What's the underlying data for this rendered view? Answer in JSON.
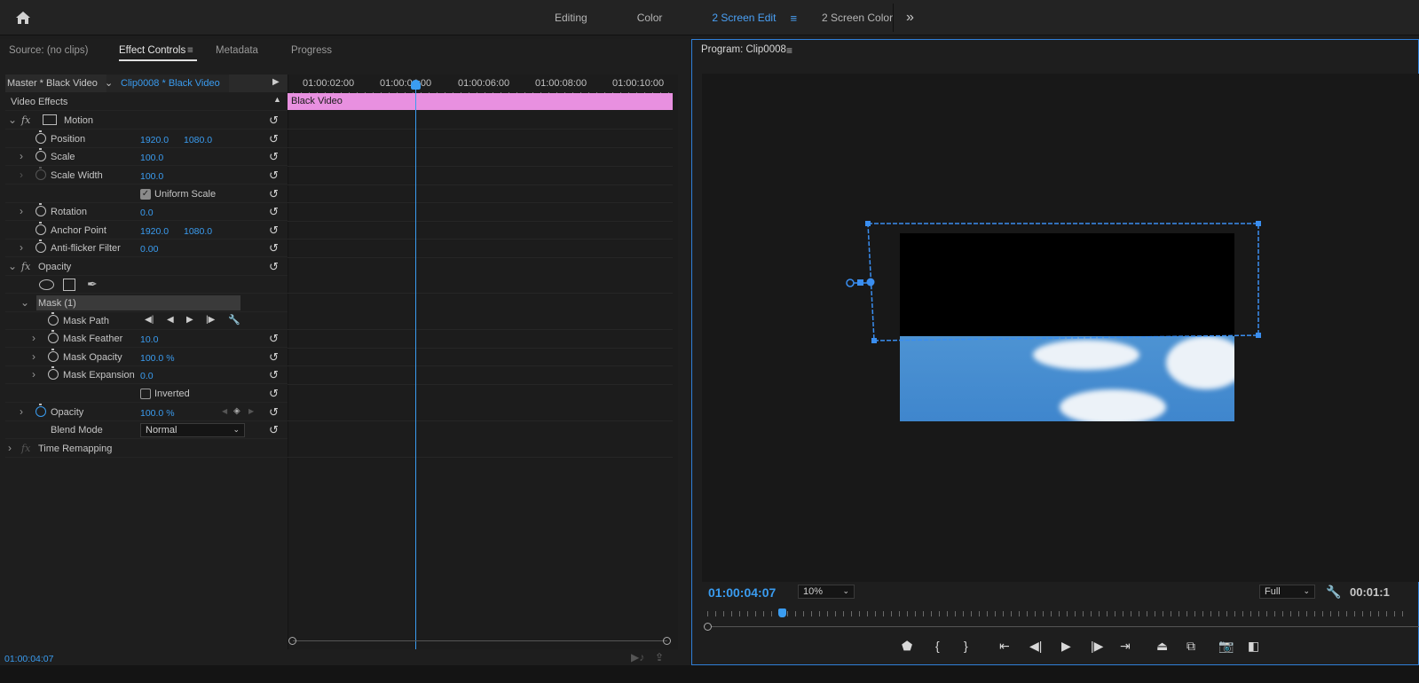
{
  "workspace": {
    "tabs": [
      {
        "label": "Editing"
      },
      {
        "label": "Color"
      },
      {
        "label": "2 Screen Edit",
        "active": true
      },
      {
        "label": "2 Screen Color"
      }
    ],
    "menu_glyph": "≡",
    "more_glyph": "»"
  },
  "left_panel": {
    "tabs": [
      "Source: (no clips)",
      "Effect Controls",
      "Metadata",
      "Progress"
    ],
    "active_tab": "Effect Controls",
    "menu_glyph": "≡",
    "master_label": "Master * Black Video",
    "clip_label": "Clip0008 * Black Video",
    "section_video_effects": "Video Effects",
    "motion": {
      "label": "Motion",
      "position": {
        "label": "Position",
        "x": "1920.0",
        "y": "1080.0"
      },
      "scale": {
        "label": "Scale",
        "value": "100.0"
      },
      "scale_width": {
        "label": "Scale Width",
        "value": "100.0"
      },
      "uniform_scale": {
        "label": "Uniform Scale",
        "checked": true
      },
      "rotation": {
        "label": "Rotation",
        "value": "0.0"
      },
      "anchor_point": {
        "label": "Anchor Point",
        "x": "1920.0",
        "y": "1080.0"
      },
      "anti_flicker": {
        "label": "Anti-flicker Filter",
        "value": "0.00"
      }
    },
    "opacity_section": {
      "label": "Opacity",
      "mask": {
        "label": "Mask (1)",
        "path_label": "Mask Path",
        "feather": {
          "label": "Mask Feather",
          "value": "10.0"
        },
        "opacity": {
          "label": "Mask Opacity",
          "value": "100.0 %"
        },
        "expansion": {
          "label": "Mask Expansion",
          "value": "0.0"
        },
        "inverted": {
          "label": "Inverted",
          "checked": false
        }
      },
      "opacity": {
        "label": "Opacity",
        "value": "100.0 %"
      },
      "blend_mode": {
        "label": "Blend Mode",
        "value": "Normal"
      }
    },
    "time_remapping": "Time Remapping",
    "timeline": {
      "timecodes": [
        "01:00:02:00",
        "01:00:04:00",
        "01:00:06:00",
        "01:00:08:00",
        "01:00:10:00"
      ],
      "clip_name": "Black Video"
    },
    "footer_timecode": "01:00:04:07"
  },
  "program": {
    "title": "Program: Clip0008",
    "menu_glyph": "≡",
    "current_timecode": "01:00:04:07",
    "zoom": "10%",
    "quality": "Full",
    "duration": "00:01:1"
  },
  "colors": {
    "accent": "#3a9cf0",
    "clip": "#e890e0",
    "mask": "#3a8ef0"
  }
}
